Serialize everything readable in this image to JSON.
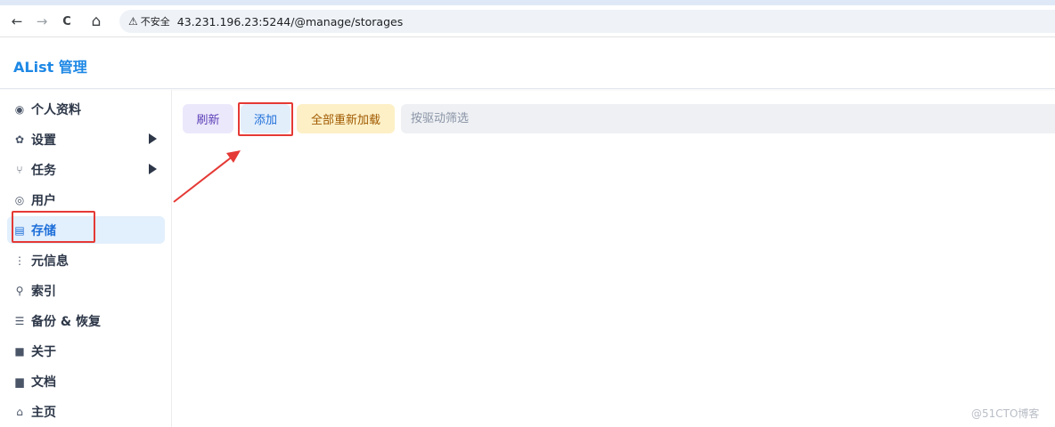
{
  "browser": {
    "back_icon": "←",
    "forward_icon": "→",
    "reload_icon": "C",
    "home_icon": "⌂",
    "security_icon": "⚠",
    "security_label": "不安全",
    "url": "43.231.196.23:5244/@manage/storages"
  },
  "app": {
    "title": "AList 管理"
  },
  "sidebar": {
    "items": [
      {
        "label": "个人资料",
        "icon": "fingerprint-icon",
        "glyph": "◉"
      },
      {
        "label": "设置",
        "icon": "gear-icon",
        "glyph": "✿"
      },
      {
        "label": "任务",
        "icon": "workflow-icon",
        "glyph": "⑂"
      },
      {
        "label": "用户",
        "icon": "user-circle-icon",
        "glyph": "◎"
      },
      {
        "label": "存储",
        "icon": "database-icon",
        "glyph": "▤"
      },
      {
        "label": "元信息",
        "icon": "meta-icon",
        "glyph": "⋮"
      },
      {
        "label": "索引",
        "icon": "search-icon",
        "glyph": "⚲"
      },
      {
        "label": "备份 & 恢复",
        "icon": "database-stack-icon",
        "glyph": "☰"
      },
      {
        "label": "关于",
        "icon": "copy-icon",
        "glyph": "■"
      },
      {
        "label": "文档",
        "icon": "book-icon",
        "glyph": "▆"
      },
      {
        "label": "主页",
        "icon": "home-icon",
        "glyph": "⌂"
      }
    ],
    "active": "存储"
  },
  "toolbar": {
    "refresh_label": "刷新",
    "add_label": "添加",
    "reload_all_label": "全部重新加载",
    "filter_placeholder": "按驱动筛选"
  },
  "colors": {
    "brand": "#1e88e5",
    "annotation": "#e53935"
  },
  "watermark": "@51CTO博客"
}
